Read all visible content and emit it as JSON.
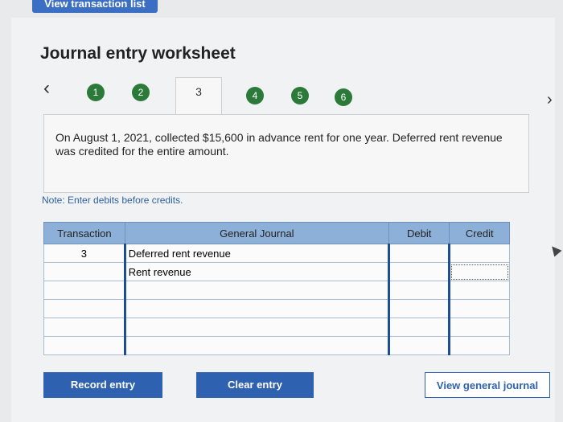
{
  "header": {
    "tab_label": "View transaction list"
  },
  "title": "Journal entry worksheet",
  "nav": {
    "prev_icon": "chevron-left-icon",
    "next_icon": "chevron-right-icon",
    "steps": [
      "1",
      "2",
      "3",
      "4",
      "5",
      "6"
    ],
    "active_step": "3"
  },
  "question": "On August 1, 2021, collected $15,600 in advance rent for one year. Deferred rent revenue was credited for the entire amount.",
  "note": "Note: Enter debits before credits.",
  "table": {
    "headers": {
      "transaction": "Transaction",
      "general_journal": "General Journal",
      "debit": "Debit",
      "credit": "Credit"
    },
    "rows": [
      {
        "transaction": "3",
        "account": "Deferred rent revenue",
        "debit": "",
        "credit": ""
      },
      {
        "transaction": "",
        "account": "Rent revenue",
        "debit": "",
        "credit": ""
      },
      {
        "transaction": "",
        "account": "",
        "debit": "",
        "credit": ""
      },
      {
        "transaction": "",
        "account": "",
        "debit": "",
        "credit": ""
      },
      {
        "transaction": "",
        "account": "",
        "debit": "",
        "credit": ""
      },
      {
        "transaction": "",
        "account": "",
        "debit": "",
        "credit": ""
      }
    ]
  },
  "buttons": {
    "record": "Record entry",
    "clear": "Clear entry",
    "view_journal": "View general journal"
  }
}
